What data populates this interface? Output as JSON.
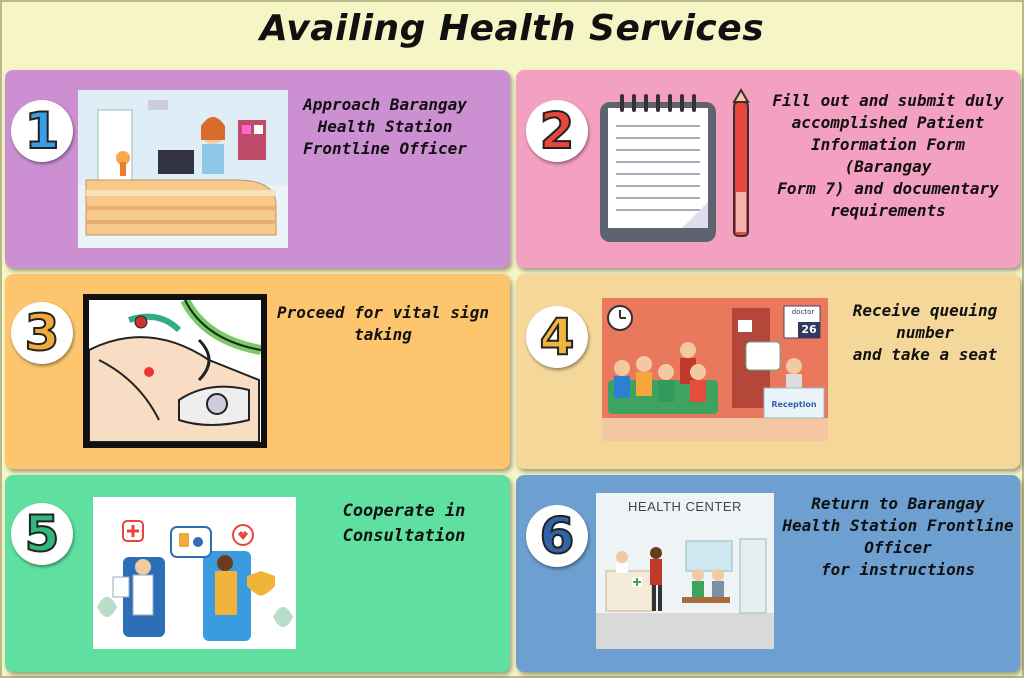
{
  "title": "Availing Health Services",
  "steps": [
    {
      "number": "1",
      "text": "Approach Barangay\nHealth Station\nFrontline Officer",
      "panel_color": "#cc8fd2",
      "number_color": "#3a9ee4",
      "icon": "reception-desk-icon"
    },
    {
      "number": "2",
      "text": "Fill out and submit duly\naccomplished Patient\nInformation Form\n(Barangay\nForm 7) and documentary\nrequirements",
      "panel_color": "#f4a0c0",
      "number_color": "#e8453c",
      "icon": "notepad-pen-icon"
    },
    {
      "number": "3",
      "text": "Proceed for vital sign\ntaking",
      "panel_color": "#fdc66e",
      "number_color": "#f2a93b",
      "icon": "blood-pressure-icon"
    },
    {
      "number": "4",
      "text": "Receive queuing\nnumber\nand take a seat",
      "panel_color": "#f6d79a",
      "number_color": "#f0b53c",
      "icon": "waiting-room-icon"
    },
    {
      "number": "5",
      "text": "Cooperate in\nConsultation",
      "panel_color": "#5fe0a0",
      "number_color": "#2fb87a",
      "icon": "online-consultation-icon"
    },
    {
      "number": "6",
      "text": "Return to Barangay\nHealth Station Frontline\nOfficer\nfor instructions",
      "panel_color": "#6e9fd1",
      "number_color": "#2f64a8",
      "icon": "health-center-icon"
    }
  ],
  "illustration_labels": {
    "queue_sign": "doctor",
    "queue_number": "26",
    "reception_sign": "Reception",
    "health_center_sign": "HEALTH CENTER"
  }
}
